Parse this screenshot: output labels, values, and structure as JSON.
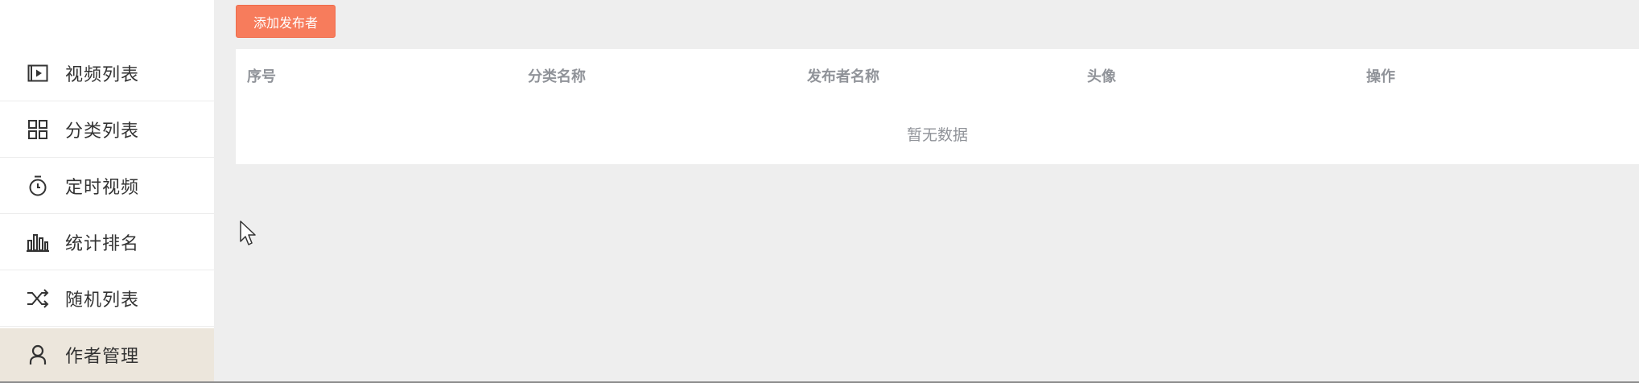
{
  "sidebar": {
    "items": [
      {
        "label": "视频列表",
        "icon": "video-icon",
        "active": false
      },
      {
        "label": "分类列表",
        "icon": "grid-icon",
        "active": false
      },
      {
        "label": "定时视频",
        "icon": "timer-icon",
        "active": false
      },
      {
        "label": "统计排名",
        "icon": "bar-chart-icon",
        "active": false
      },
      {
        "label": "随机列表",
        "icon": "shuffle-icon",
        "active": false
      },
      {
        "label": "作者管理",
        "icon": "user-icon",
        "active": true
      }
    ]
  },
  "toolbar": {
    "add_publisher_label": "添加发布者"
  },
  "table": {
    "columns": [
      "序号",
      "分类名称",
      "发布者名称",
      "头像",
      "操作"
    ],
    "rows": [],
    "empty_text": "暂无数据"
  },
  "colors": {
    "accent": "#f77c5c",
    "active_nav_bg": "#ece6dc",
    "page_bg": "#eeeeee",
    "header_text": "#909399"
  }
}
